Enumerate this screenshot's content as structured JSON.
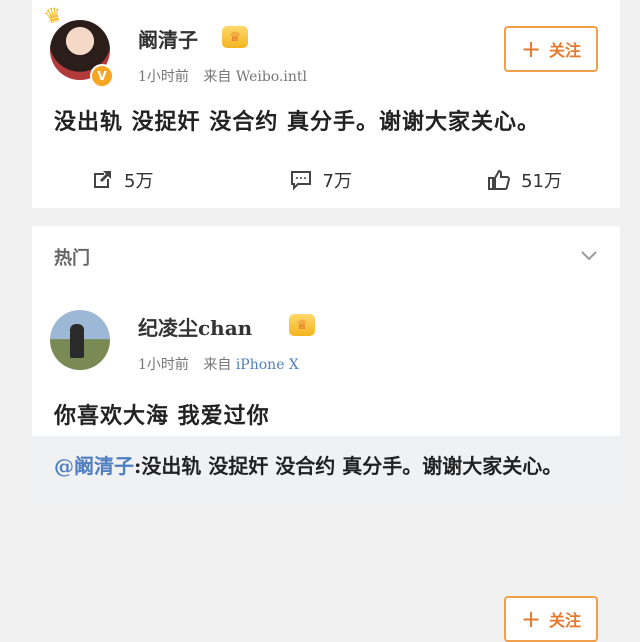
{
  "post1": {
    "user": "阚清子",
    "vip_icon": "vip-crown-icon",
    "meta_time": "1小时前",
    "meta_from_label": "来自",
    "meta_source": "Weibo.intl",
    "follow_label": "关注",
    "text": "没出轨 没捉奸 没合约 真分手。谢谢大家关心。",
    "actions": {
      "share_count": "5万",
      "comment_count": "7万",
      "like_count": "51万"
    }
  },
  "hot": {
    "title": "热门"
  },
  "post2": {
    "user": "纪凌尘chan",
    "vip_icon": "vip-crown-icon",
    "meta_time": "1小时前",
    "meta_from_label": "来自",
    "meta_source": "iPhone X",
    "follow_label": "关注",
    "text": "你喜欢大海 我爱过你",
    "quote_mention": "@阚清子",
    "quote_text": ":没出轨 没捉奸 没合约 真分手。谢谢大家关心。"
  }
}
